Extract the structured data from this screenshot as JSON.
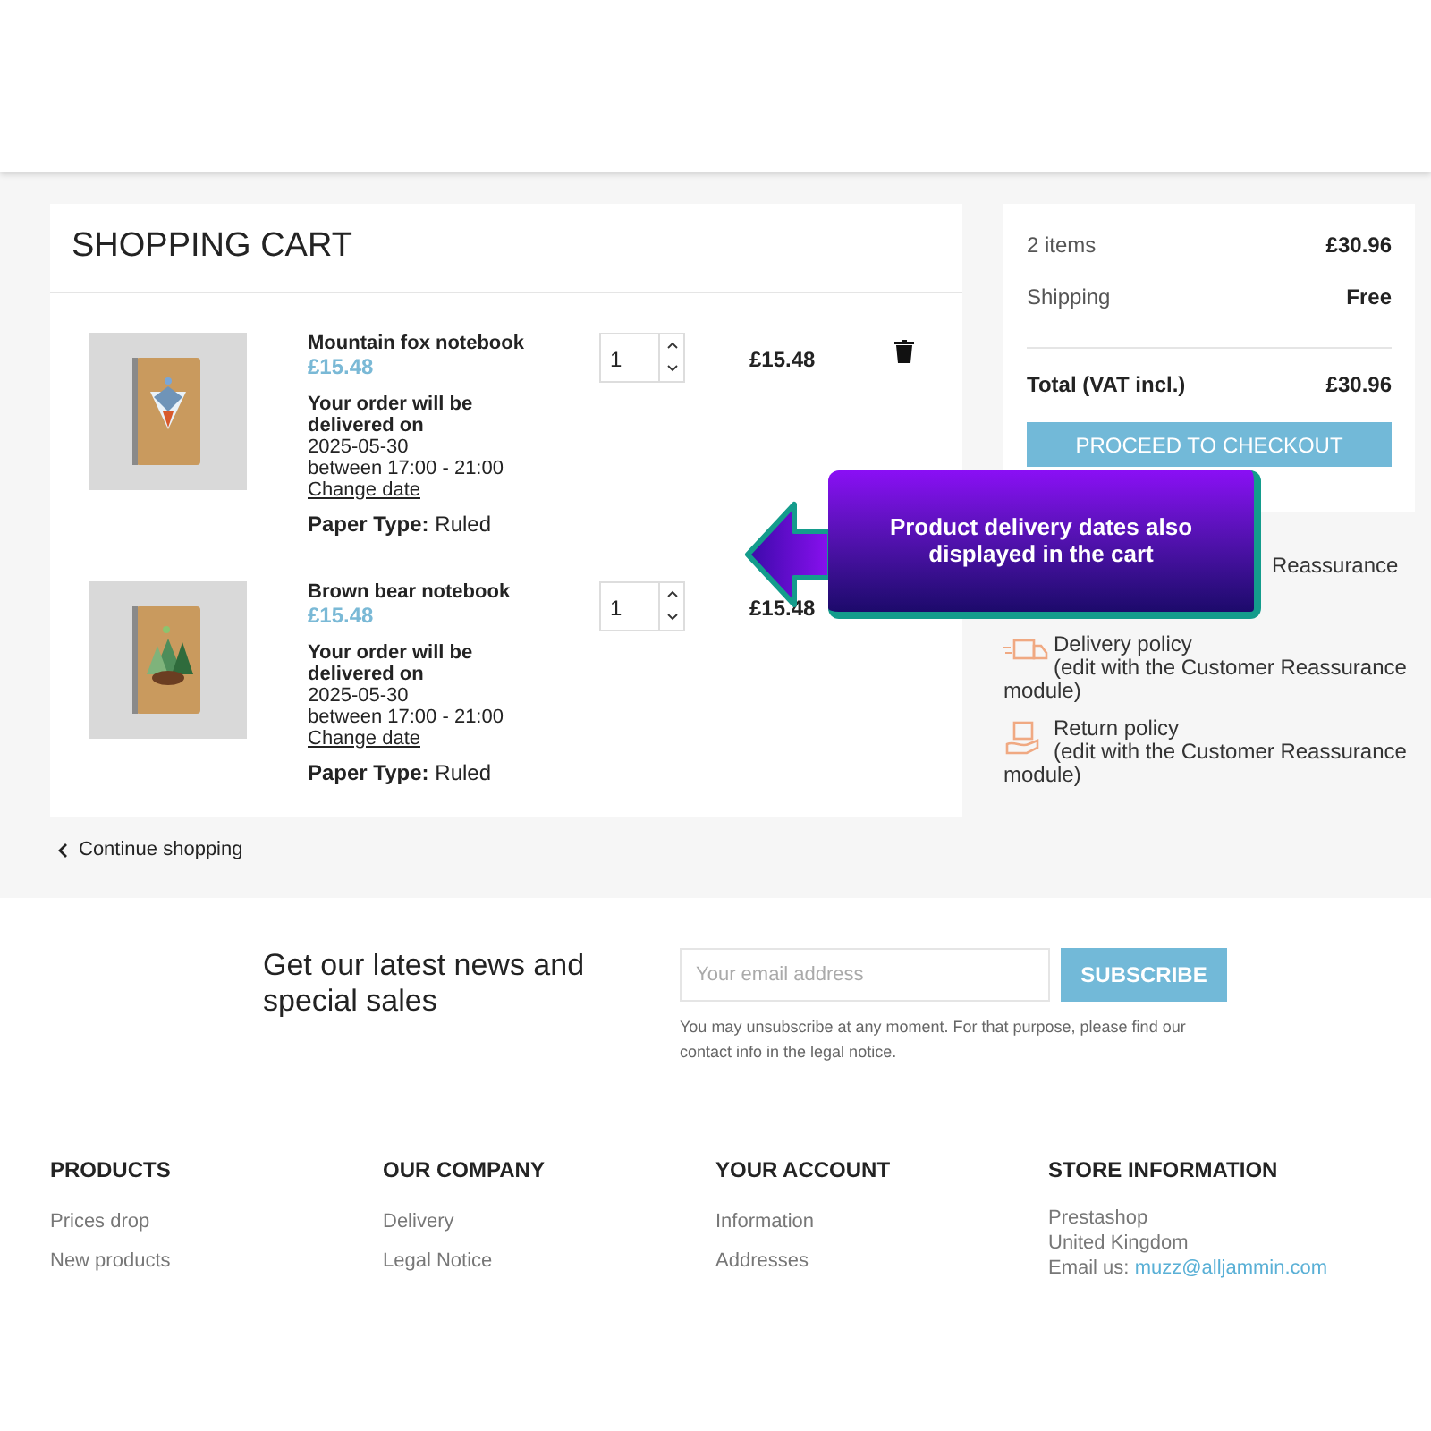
{
  "cart": {
    "title": "SHOPPING CART",
    "items": [
      {
        "name": "Mountain fox notebook",
        "unit_price": "£15.48",
        "quantity": "1",
        "total": "£15.48",
        "delivery_heading": "Your order will be delivered on",
        "delivery_date": "2025-05-30",
        "delivery_window": "between 17:00 - 21:00",
        "change_link": "Change date",
        "attribute_label": "Paper Type:",
        "attribute_value": "Ruled"
      },
      {
        "name": "Brown bear notebook",
        "unit_price": "£15.48",
        "quantity": "1",
        "total": "£15.48",
        "delivery_heading": "Your order will be delivered on",
        "delivery_date": "2025-05-30",
        "delivery_window": "between 17:00 - 21:00",
        "change_link": "Change date",
        "attribute_label": "Paper Type:",
        "attribute_value": "Ruled"
      }
    ],
    "continue_link": "Continue shopping"
  },
  "summary": {
    "lines": [
      {
        "label": "2 items",
        "value": "£30.96"
      },
      {
        "label": "Shipping",
        "value": "Free"
      }
    ],
    "total_label": "Total (VAT incl.)",
    "total_value": "£30.96",
    "checkout_button": "PROCEED TO CHECKOUT"
  },
  "reassurance": [
    {
      "kind": "covered",
      "text": "Reassurance"
    },
    {
      "kind": "delivery",
      "title": "Delivery policy",
      "text": "(edit with the Customer Reassurance module)"
    },
    {
      "kind": "return",
      "title": "Return policy",
      "text": "(edit with the Customer Reassurance module)"
    }
  ],
  "callout": {
    "text": "Product delivery dates also displayed in the cart"
  },
  "newsletter": {
    "heading": "Get our latest news and special sales",
    "placeholder": "Your email address",
    "button": "SUBSCRIBE",
    "note": "You may unsubscribe at any moment. For that purpose, please find our contact info in the legal notice."
  },
  "footer": {
    "columns": [
      {
        "title": "PRODUCTS",
        "links": [
          "Prices drop",
          "New products"
        ]
      },
      {
        "title": "OUR COMPANY",
        "links": [
          "Delivery",
          "Legal Notice"
        ]
      },
      {
        "title": "YOUR ACCOUNT",
        "links": [
          "Information",
          "Addresses"
        ]
      }
    ],
    "store": {
      "title": "STORE INFORMATION",
      "lines": [
        "Prestashop",
        "United Kingdom"
      ],
      "email_label": "Email us:",
      "email": "muzz@alljammin.com"
    }
  }
}
